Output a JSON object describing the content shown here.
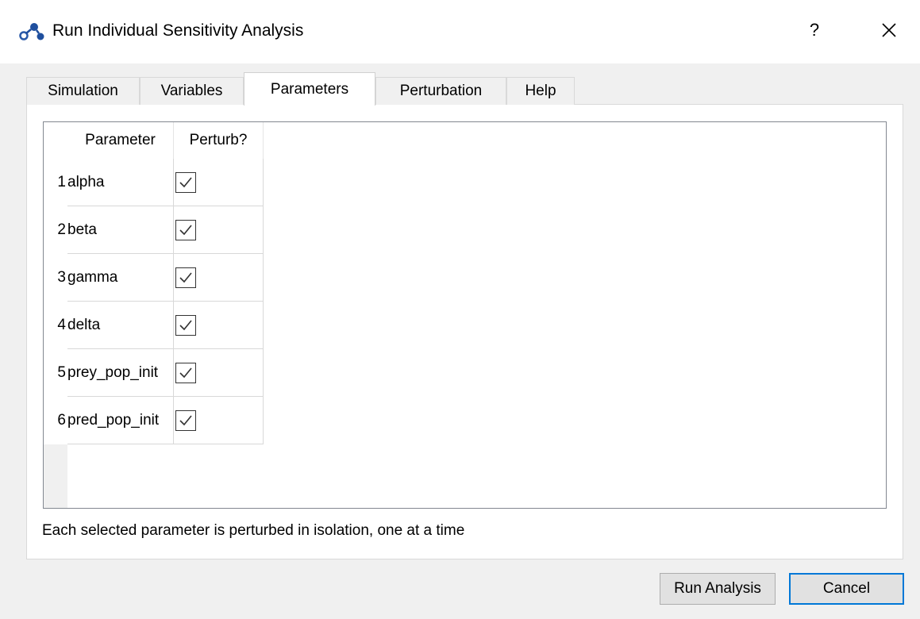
{
  "window": {
    "title": "Run Individual Sensitivity Analysis",
    "help_label": "?",
    "close_icon": "close-icon"
  },
  "tabs": [
    {
      "label": "Simulation",
      "active": false
    },
    {
      "label": "Variables",
      "active": false
    },
    {
      "label": "Parameters",
      "active": true
    },
    {
      "label": "Perturbation",
      "active": false
    },
    {
      "label": "Help",
      "active": false
    }
  ],
  "table": {
    "columns": [
      "Parameter",
      "Perturb?"
    ],
    "rows": [
      {
        "num": "1",
        "parameter": "alpha",
        "perturb": true
      },
      {
        "num": "2",
        "parameter": "beta",
        "perturb": true
      },
      {
        "num": "3",
        "parameter": "gamma",
        "perturb": true
      },
      {
        "num": "4",
        "parameter": "delta",
        "perturb": true
      },
      {
        "num": "5",
        "parameter": "prey_pop_init",
        "perturb": true
      },
      {
        "num": "6",
        "parameter": "pred_pop_init",
        "perturb": true
      }
    ]
  },
  "info_text": "Each selected parameter is perturbed in isolation, one at a time",
  "buttons": {
    "run_label": "Run Analysis",
    "cancel_label": "Cancel"
  },
  "colors": {
    "accent": "#0078d7",
    "dialog_bg": "#f0f0f0"
  }
}
